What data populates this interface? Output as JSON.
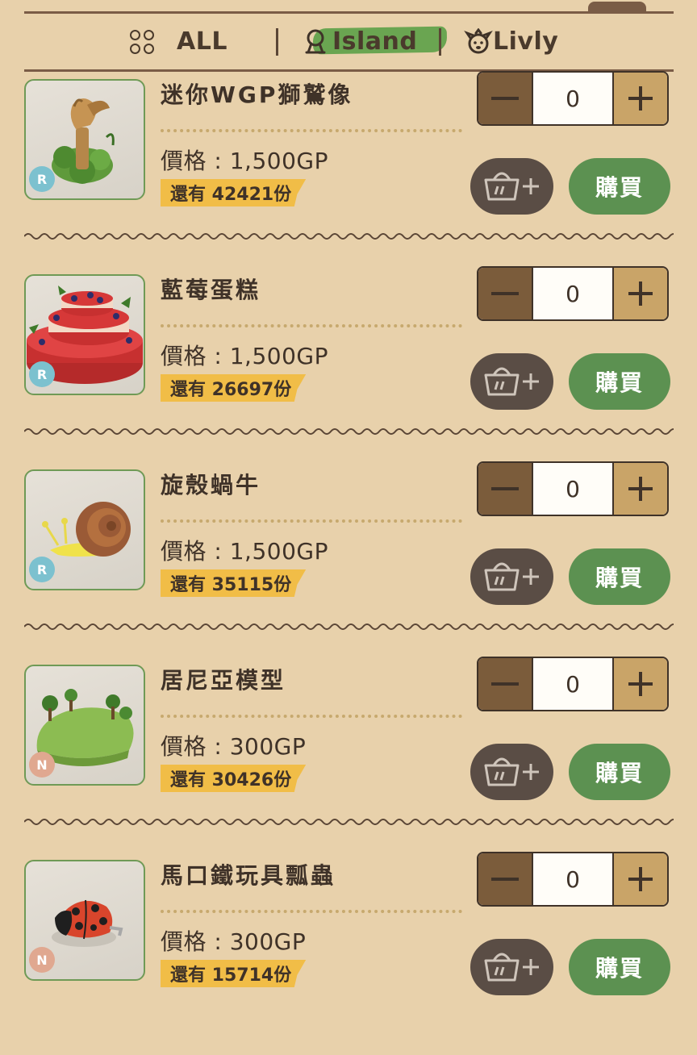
{
  "tabs": [
    {
      "label": "ALL",
      "icon": "grid-dots-icon"
    },
    {
      "label": "Island",
      "icon": "island-icon",
      "active": true
    },
    {
      "label": "Livly",
      "icon": "livly-icon"
    }
  ],
  "colors": {
    "background": "#e8d1ab",
    "accent_green": "#5c9151",
    "tab_highlight": "#6aa551",
    "stock_tag": "#f1bd47",
    "rarity_r": "#7cc1cf",
    "rarity_n": "#e0a890"
  },
  "buy_label": "購買",
  "items": [
    {
      "name": "迷你WGP獅鷲像",
      "price": "價格 : 1,500GP",
      "stock": "還有 42421份",
      "quantity": "0",
      "rarity": "R",
      "image": "griffin-statue"
    },
    {
      "name": "藍莓蛋糕",
      "price": "價格 : 1,500GP",
      "stock": "還有 26697份",
      "quantity": "0",
      "rarity": "R",
      "image": "blueberry-cake"
    },
    {
      "name": "旋殼蝸牛",
      "price": "價格 : 1,500GP",
      "stock": "還有 35115份",
      "quantity": "0",
      "rarity": "R",
      "image": "snail"
    },
    {
      "name": "居尼亞模型",
      "price": "價格 : 300GP",
      "stock": "還有 30426份",
      "quantity": "0",
      "rarity": "N",
      "image": "island-model"
    },
    {
      "name": "馬口鐵玩具瓢蟲",
      "price": "價格 : 300GP",
      "stock": "還有 15714份",
      "quantity": "0",
      "rarity": "N",
      "image": "tin-ladybug"
    }
  ]
}
